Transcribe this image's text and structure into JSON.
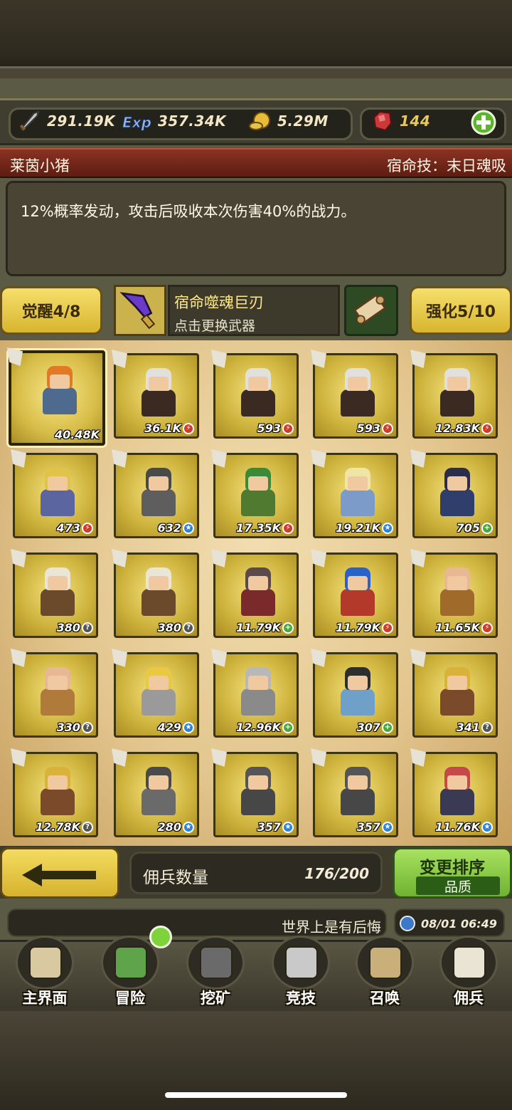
{
  "resources": {
    "attack": {
      "icon": "sword-icon",
      "value": "291.19K"
    },
    "exp": {
      "icon": "exp-icon",
      "value": "357.34K"
    },
    "gold": {
      "icon": "coin-icon",
      "value": "5.29M"
    },
    "gem": {
      "icon": "ruby-icon",
      "value": "144"
    }
  },
  "hero": {
    "name": "莱茵小猪",
    "skill": "宿命技：末日魂吸",
    "description": "12%概率发动，攻击后吸收本次伤害40%的战力。"
  },
  "weapon": {
    "awaken_label": "觉醒4/8",
    "name": "宿命噬魂巨刃",
    "hint": "点击更换武器",
    "enhance_label": "强化5/10"
  },
  "mercenaries": [
    {
      "power": "40.48K",
      "badge": "",
      "selected": true,
      "colors": {
        "hair": "#e27a23",
        "body": "#4f6a8f"
      }
    },
    {
      "power": "36.1K",
      "badge": "red",
      "colors": {
        "hair": "#e2e0dc",
        "body": "#3a2a22"
      }
    },
    {
      "power": "593",
      "badge": "red",
      "colors": {
        "hair": "#e2e0dc",
        "body": "#3a2a22"
      }
    },
    {
      "power": "593",
      "badge": "red",
      "colors": {
        "hair": "#e2e0dc",
        "body": "#3a2a22"
      }
    },
    {
      "power": "12.83K",
      "badge": "red",
      "colors": {
        "hair": "#e2e0dc",
        "body": "#3a2a22"
      }
    },
    {
      "power": "473",
      "badge": "red",
      "colors": {
        "hair": "#e2c34a",
        "body": "#5b66a0"
      }
    },
    {
      "power": "632",
      "badge": "blue",
      "colors": {
        "hair": "#4a4a4a",
        "body": "#5e5e5e"
      }
    },
    {
      "power": "17.35K",
      "badge": "red",
      "colors": {
        "hair": "#3b8a3a",
        "body": "#4f7a2f"
      }
    },
    {
      "power": "19.21K",
      "badge": "blue",
      "colors": {
        "hair": "#f0e4a6",
        "body": "#7c9bc9"
      }
    },
    {
      "power": "705",
      "badge": "green",
      "colors": {
        "hair": "#2b2d4a",
        "body": "#2f3e6b"
      }
    },
    {
      "power": "380",
      "badge": "grey",
      "colors": {
        "hair": "#e9e6d8",
        "body": "#6a4a2a"
      }
    },
    {
      "power": "380",
      "badge": "grey",
      "colors": {
        "hair": "#e9e6d8",
        "body": "#6a4a2a"
      }
    },
    {
      "power": "11.79K",
      "badge": "green",
      "colors": {
        "hair": "#5a4a4a",
        "body": "#7a2a2a"
      }
    },
    {
      "power": "11.79K",
      "badge": "red",
      "colors": {
        "hair": "#2a62c9",
        "body": "#b33a2a"
      }
    },
    {
      "power": "11.65K",
      "badge": "red",
      "colors": {
        "hair": "#e8b894",
        "body": "#a06a2a"
      }
    },
    {
      "power": "330",
      "badge": "grey",
      "colors": {
        "hair": "#e8b894",
        "body": "#b07a3a"
      }
    },
    {
      "power": "429",
      "badge": "blue",
      "colors": {
        "hair": "#e9c842",
        "body": "#9a9a9a"
      }
    },
    {
      "power": "12.96K",
      "badge": "green",
      "colors": {
        "hair": "#b8b8b8",
        "body": "#8a8a8a"
      }
    },
    {
      "power": "307",
      "badge": "green",
      "colors": {
        "hair": "#2e2e2e",
        "body": "#6fa0c9"
      }
    },
    {
      "power": "341",
      "badge": "grey",
      "colors": {
        "hair": "#d9b23a",
        "body": "#7a4a2a"
      }
    },
    {
      "power": "12.78K",
      "badge": "grey",
      "colors": {
        "hair": "#d9b23a",
        "body": "#7a4a2a"
      }
    },
    {
      "power": "280",
      "badge": "blue",
      "colors": {
        "hair": "#4a4a4a",
        "body": "#6a6a6a"
      }
    },
    {
      "power": "357",
      "badge": "blue",
      "colors": {
        "hair": "#555555",
        "body": "#474747"
      }
    },
    {
      "power": "357",
      "badge": "blue",
      "colors": {
        "hair": "#555555",
        "body": "#474747"
      }
    },
    {
      "power": "11.76K",
      "badge": "blue",
      "colors": {
        "hair": "#c44a4a",
        "body": "#3a3a55"
      }
    }
  ],
  "footer": {
    "count_label": "佣兵数量",
    "count_value": "176/200",
    "sort_title": "变更排序",
    "sort_sub": "品质"
  },
  "ticker": {
    "text": "世界上是有后悔",
    "time": "08/01 06:49"
  },
  "nav": [
    {
      "label": "主界面",
      "icon": "map-scroll-icon"
    },
    {
      "label": "冒险",
      "icon": "island-icon"
    },
    {
      "label": "挖矿",
      "icon": "pickaxe-icon"
    },
    {
      "label": "竞技",
      "icon": "crossed-swords-icon"
    },
    {
      "label": "召唤",
      "icon": "summon-scroll-icon"
    },
    {
      "label": "佣兵",
      "icon": "tent-icon"
    }
  ]
}
